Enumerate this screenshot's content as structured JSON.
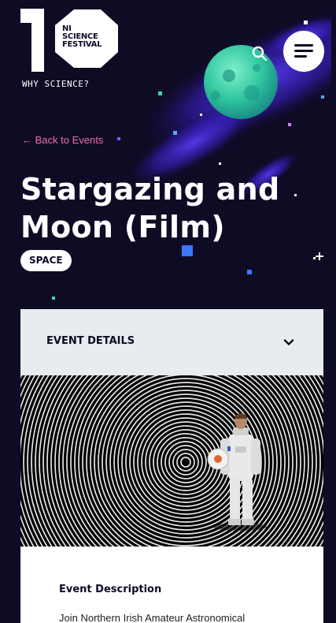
{
  "header": {
    "logo_numeral": "10",
    "logo_line1": "NI",
    "logo_line2": "SCIENCE",
    "logo_line3": "FESTIVAL",
    "tagline": "WHY SCIENCE?",
    "search_icon": "search-icon",
    "menu_icon": "hamburger-menu-icon"
  },
  "event": {
    "back_label": "← Back to Events",
    "title": "Stargazing and Moon (Film)",
    "tag": "SPACE"
  },
  "details": {
    "label": "EVENT DETAILS",
    "toggle_icon": "chevron-down-icon"
  },
  "description": {
    "title": "Event Description",
    "text": "Join Northern Irish Amateur Astronomical"
  },
  "colors": {
    "background": "#0e0b25",
    "accent_pink": "#f06ba6",
    "details_bg": "#e8ecef",
    "white": "#ffffff"
  }
}
